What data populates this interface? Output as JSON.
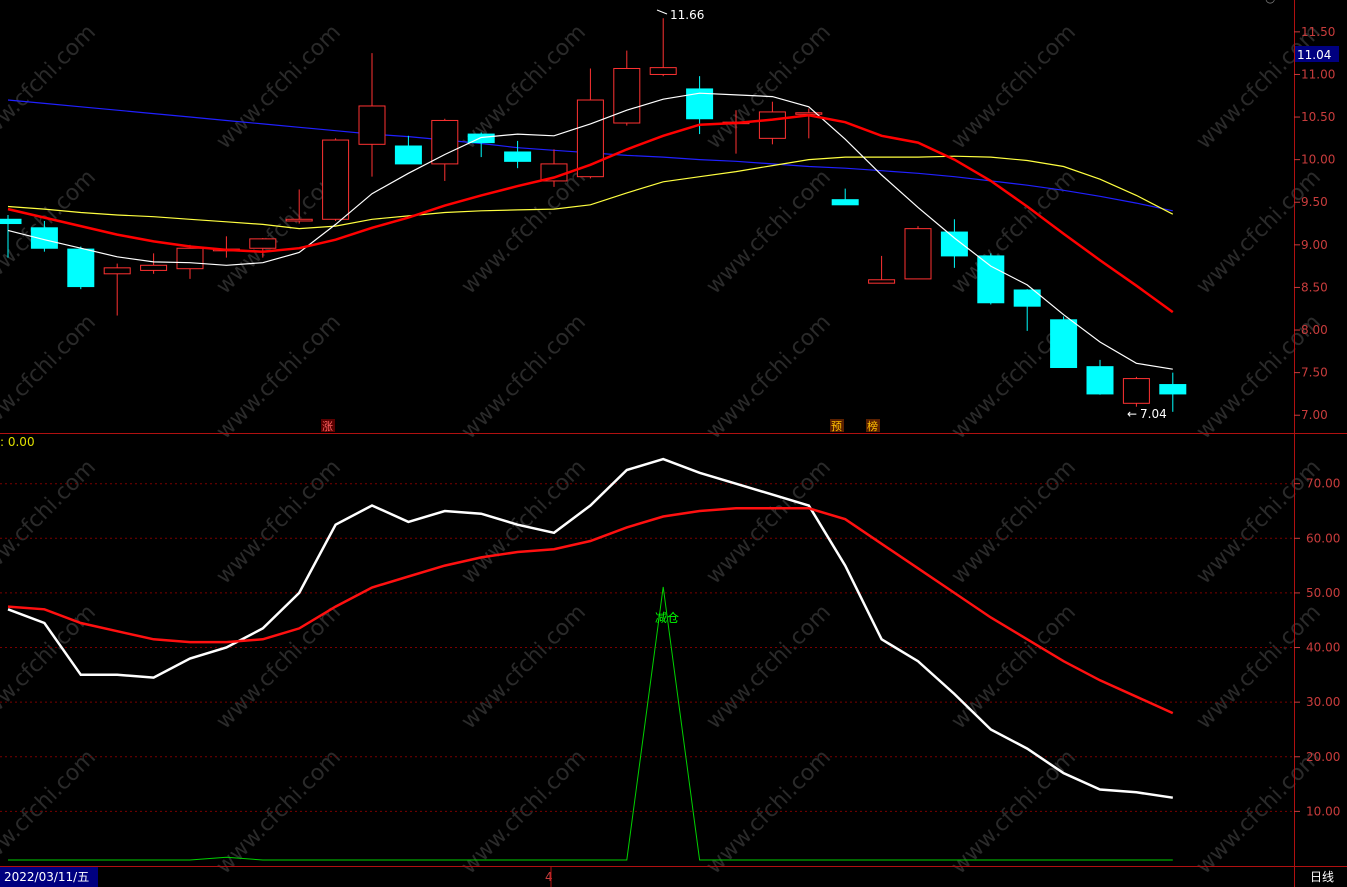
{
  "header": {
    "indicator_label": ": 0.00",
    "price_box": "11.04"
  },
  "footer": {
    "date_label": "2022/03/11/五",
    "mid_label": "4",
    "period_label": "日线"
  },
  "markers": {
    "high_label": "11.66",
    "low_label": "7.04",
    "rise_tag": "涨",
    "pre_tag": "预",
    "rank_tag": "榜",
    "signal_label": "减仓"
  },
  "watermark": "www.cfchi.com",
  "colors": {
    "background": "#000000",
    "up": "#ff3232",
    "down": "#00ffff",
    "grid": "#7a0000",
    "ma_fast": "#ffffff",
    "ma_mid": "#ff0000",
    "ma_slow": "#ffff40",
    "ma_long": "#2020ff",
    "osc_fast": "#ffffff",
    "osc_slow": "#ff1010",
    "signal": "#00d000"
  },
  "chart_data": [
    {
      "type": "candlestick",
      "ylim": [
        6.85,
        11.78
      ],
      "yticks": [
        "11.50",
        "11.00",
        "10.50",
        "10.00",
        "9.50",
        "9.00",
        "8.50",
        "8.00",
        "7.50",
        "7.00"
      ],
      "candles": [
        {
          "o": 9.3,
          "h": 9.35,
          "l": 8.85,
          "c": 9.25
        },
        {
          "o": 9.2,
          "h": 9.28,
          "l": 8.92,
          "c": 8.96
        },
        {
          "o": 8.95,
          "h": 8.98,
          "l": 8.48,
          "c": 8.51
        },
        {
          "o": 8.66,
          "h": 8.78,
          "l": 8.17,
          "c": 8.73
        },
        {
          "o": 8.7,
          "h": 8.9,
          "l": 8.66,
          "c": 8.76
        },
        {
          "o": 8.72,
          "h": 9.0,
          "l": 8.6,
          "c": 8.96
        },
        {
          "o": 8.93,
          "h": 9.1,
          "l": 8.85,
          "c": 8.95
        },
        {
          "o": 8.96,
          "h": 9.08,
          "l": 8.85,
          "c": 9.07
        },
        {
          "o": 9.28,
          "h": 9.65,
          "l": 9.25,
          "c": 9.3
        },
        {
          "o": 9.3,
          "h": 10.25,
          "l": 9.28,
          "c": 10.23
        },
        {
          "o": 10.18,
          "h": 11.25,
          "l": 9.8,
          "c": 10.63
        },
        {
          "o": 10.16,
          "h": 10.28,
          "l": 9.95,
          "c": 9.95
        },
        {
          "o": 9.95,
          "h": 10.48,
          "l": 9.75,
          "c": 10.46
        },
        {
          "o": 10.3,
          "h": 10.32,
          "l": 10.03,
          "c": 10.2
        },
        {
          "o": 10.09,
          "h": 10.22,
          "l": 9.9,
          "c": 9.98
        },
        {
          "o": 9.75,
          "h": 10.12,
          "l": 9.68,
          "c": 9.95
        },
        {
          "o": 9.8,
          "h": 11.07,
          "l": 9.78,
          "c": 10.7
        },
        {
          "o": 10.43,
          "h": 11.28,
          "l": 10.4,
          "c": 11.07
        },
        {
          "o": 11.0,
          "h": 11.66,
          "l": 10.98,
          "c": 11.08
        },
        {
          "o": 10.83,
          "h": 10.98,
          "l": 10.3,
          "c": 10.48
        },
        {
          "o": 10.44,
          "h": 10.58,
          "l": 10.07,
          "c": 10.44
        },
        {
          "o": 10.25,
          "h": 10.68,
          "l": 10.18,
          "c": 10.56
        },
        {
          "o": 10.55,
          "h": 10.6,
          "l": 10.25,
          "c": 10.55
        },
        {
          "o": 9.53,
          "h": 9.66,
          "l": 9.47,
          "c": 9.47
        },
        {
          "o": 8.55,
          "h": 8.87,
          "l": 8.55,
          "c": 8.59
        },
        {
          "o": 8.6,
          "h": 9.22,
          "l": 8.6,
          "c": 9.19
        },
        {
          "o": 9.15,
          "h": 9.3,
          "l": 8.73,
          "c": 8.87
        },
        {
          "o": 8.87,
          "h": 8.9,
          "l": 8.3,
          "c": 8.32
        },
        {
          "o": 8.47,
          "h": 8.48,
          "l": 7.99,
          "c": 8.28
        },
        {
          "o": 8.12,
          "h": 8.16,
          "l": 7.56,
          "c": 7.56
        },
        {
          "o": 7.57,
          "h": 7.65,
          "l": 7.24,
          "c": 7.25
        },
        {
          "o": 7.14,
          "h": 7.45,
          "l": 7.1,
          "c": 7.43
        },
        {
          "o": 7.36,
          "h": 7.5,
          "l": 7.04,
          "c": 7.25
        }
      ],
      "ma_fast": [
        9.17,
        9.06,
        8.96,
        8.86,
        8.8,
        8.79,
        8.76,
        8.79,
        8.91,
        9.24,
        9.6,
        9.84,
        10.06,
        10.26,
        10.3,
        10.28,
        10.42,
        10.58,
        10.71,
        10.78,
        10.76,
        10.74,
        10.62,
        10.24,
        9.82,
        9.44,
        9.08,
        8.75,
        8.53,
        8.18,
        7.86,
        7.61,
        7.54
      ],
      "ma_mid": [
        9.42,
        9.32,
        9.22,
        9.12,
        9.04,
        8.98,
        8.94,
        8.92,
        8.96,
        9.06,
        9.2,
        9.32,
        9.46,
        9.58,
        9.69,
        9.79,
        9.94,
        10.12,
        10.28,
        10.41,
        10.43,
        10.47,
        10.52,
        10.44,
        10.28,
        10.2,
        10.0,
        9.75,
        9.45,
        9.13,
        8.82,
        8.52,
        8.21
      ],
      "ma_slow": [
        9.45,
        9.42,
        9.38,
        9.35,
        9.33,
        9.3,
        9.27,
        9.24,
        9.19,
        9.22,
        9.3,
        9.34,
        9.38,
        9.4,
        9.41,
        9.42,
        9.47,
        9.61,
        9.74,
        9.8,
        9.86,
        9.93,
        10.0,
        10.03,
        10.03,
        10.03,
        10.04,
        10.03,
        9.99,
        9.92,
        9.77,
        9.58,
        9.36
      ],
      "ma_long": [
        10.7,
        10.66,
        10.62,
        10.58,
        10.54,
        10.5,
        10.46,
        10.42,
        10.38,
        10.34,
        10.3,
        10.27,
        10.23,
        10.19,
        10.14,
        10.11,
        10.08,
        10.05,
        10.03,
        10.0,
        9.98,
        9.95,
        9.92,
        9.9,
        9.87,
        9.84,
        9.8,
        9.75,
        9.7,
        9.64,
        9.57,
        9.49,
        9.4
      ]
    },
    {
      "type": "line",
      "ylim": [
        0,
        78
      ],
      "yticks": [
        "70.00",
        "60.00",
        "50.00",
        "40.00",
        "30.00",
        "20.00",
        "10.00"
      ],
      "series": [
        {
          "values": [
            47.0,
            44.5,
            35.0,
            35.0,
            34.5,
            38.0,
            40.0,
            43.5,
            50.0,
            62.5,
            66.0,
            63.0,
            65.0,
            64.5,
            62.5,
            61.0,
            66.0,
            72.5,
            74.5,
            72.0,
            70.0,
            68.0,
            66.0,
            55.0,
            41.5,
            37.5,
            31.5,
            25.0,
            21.5,
            17.0,
            14.0,
            13.5,
            12.5
          ]
        },
        {
          "values": [
            47.5,
            47.0,
            44.5,
            43.0,
            41.5,
            41.0,
            41.0,
            41.5,
            43.5,
            47.5,
            51.0,
            53.0,
            55.0,
            56.5,
            57.5,
            58.0,
            59.5,
            62.0,
            64.0,
            65.0,
            65.5,
            65.5,
            65.5,
            63.5,
            59.0,
            54.5,
            50.0,
            45.5,
            41.5,
            37.5,
            34.0,
            31.0,
            28.0
          ]
        },
        {
          "values": [
            0,
            0,
            0,
            0,
            0,
            0,
            0.5,
            0,
            0,
            0,
            0,
            0,
            0,
            0,
            0,
            0,
            0,
            0,
            50,
            0,
            0,
            0,
            0,
            0,
            0,
            0,
            0,
            0,
            0,
            0,
            0,
            0,
            0
          ]
        }
      ]
    }
  ]
}
